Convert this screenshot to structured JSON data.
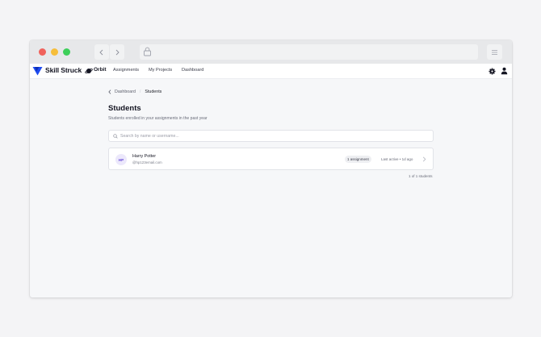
{
  "browser": {
    "icons": [
      "back-arrow-icon",
      "forward-arrow-icon",
      "lock-icon",
      "menu-icon"
    ],
    "traffic_lights": {
      "red": "#f0625c",
      "yellow": "#f6be3b",
      "green": "#3dcf5a"
    }
  },
  "header": {
    "brand": "Skill Struck",
    "brand_color": "#1f4cf0",
    "product": "Orbit",
    "nav": [
      "Assignments",
      "My Projects",
      "Dashboard"
    ],
    "icons": [
      "settings-gear-icon",
      "user-account-icon"
    ]
  },
  "breadcrumb": {
    "parent": "Dashboard",
    "current": "Students"
  },
  "page": {
    "title": "Students",
    "subtitle": "Students enrolled in your assignments in the past year"
  },
  "search": {
    "placeholder": "Search by name or username...",
    "value": ""
  },
  "students": [
    {
      "initials": "HP",
      "name": "Harry Potter",
      "email": "@hp123email.com",
      "assignments": "1 assignment",
      "last_active": "Last active • 1d ago"
    }
  ],
  "pagination": {
    "count_text": "1 of 1 students"
  },
  "colors": {
    "avatar_bg": "#ece8fb",
    "avatar_text": "#6b4fd8"
  }
}
